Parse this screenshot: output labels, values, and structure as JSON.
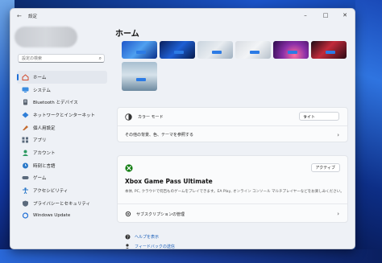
{
  "window": {
    "title": "設定",
    "back_symbol": "←",
    "minimize_symbol": "–",
    "maximize_symbol": "□",
    "close_symbol": "✕"
  },
  "sidebar": {
    "search_placeholder": "設定の検索",
    "items": [
      {
        "label": "ホーム",
        "icon": "home-icon",
        "active": true
      },
      {
        "label": "システム",
        "icon": "system-icon"
      },
      {
        "label": "Bluetooth とデバイス",
        "icon": "bluetooth-icon"
      },
      {
        "label": "ネットワークとインターネット",
        "icon": "network-icon"
      },
      {
        "label": "個人用設定",
        "icon": "personalization-icon"
      },
      {
        "label": "アプリ",
        "icon": "apps-icon"
      },
      {
        "label": "アカウント",
        "icon": "accounts-icon"
      },
      {
        "label": "時刻と言語",
        "icon": "time-language-icon"
      },
      {
        "label": "ゲーム",
        "icon": "gaming-icon"
      },
      {
        "label": "アクセシビリティ",
        "icon": "accessibility-icon"
      },
      {
        "label": "プライバシーとセキュリティ",
        "icon": "privacy-icon"
      },
      {
        "label": "Windows Update",
        "icon": "windows-update-icon"
      }
    ]
  },
  "main": {
    "title": "ホーム",
    "personalize": {
      "color_mode_label": "カラー モード",
      "color_mode_value": "ライト",
      "more_label": "その他の背景、色、テーマを参照する"
    },
    "xbox": {
      "badge": "アクティブ",
      "title": "Xbox Game Pass Ultimate",
      "description": "本体, PC, クラウドで何百ものゲームをプレイできます。EA Play, オンライン コンソール マルチプレイヤーなどをお楽しみください。",
      "manage_label": "サブスクリプションの管理"
    },
    "links": {
      "help": "ヘルプを表示",
      "feedback": "フィードバックの送信"
    }
  },
  "colors": {
    "accent": "#1f6fd6",
    "xbox_green": "#107c10"
  }
}
